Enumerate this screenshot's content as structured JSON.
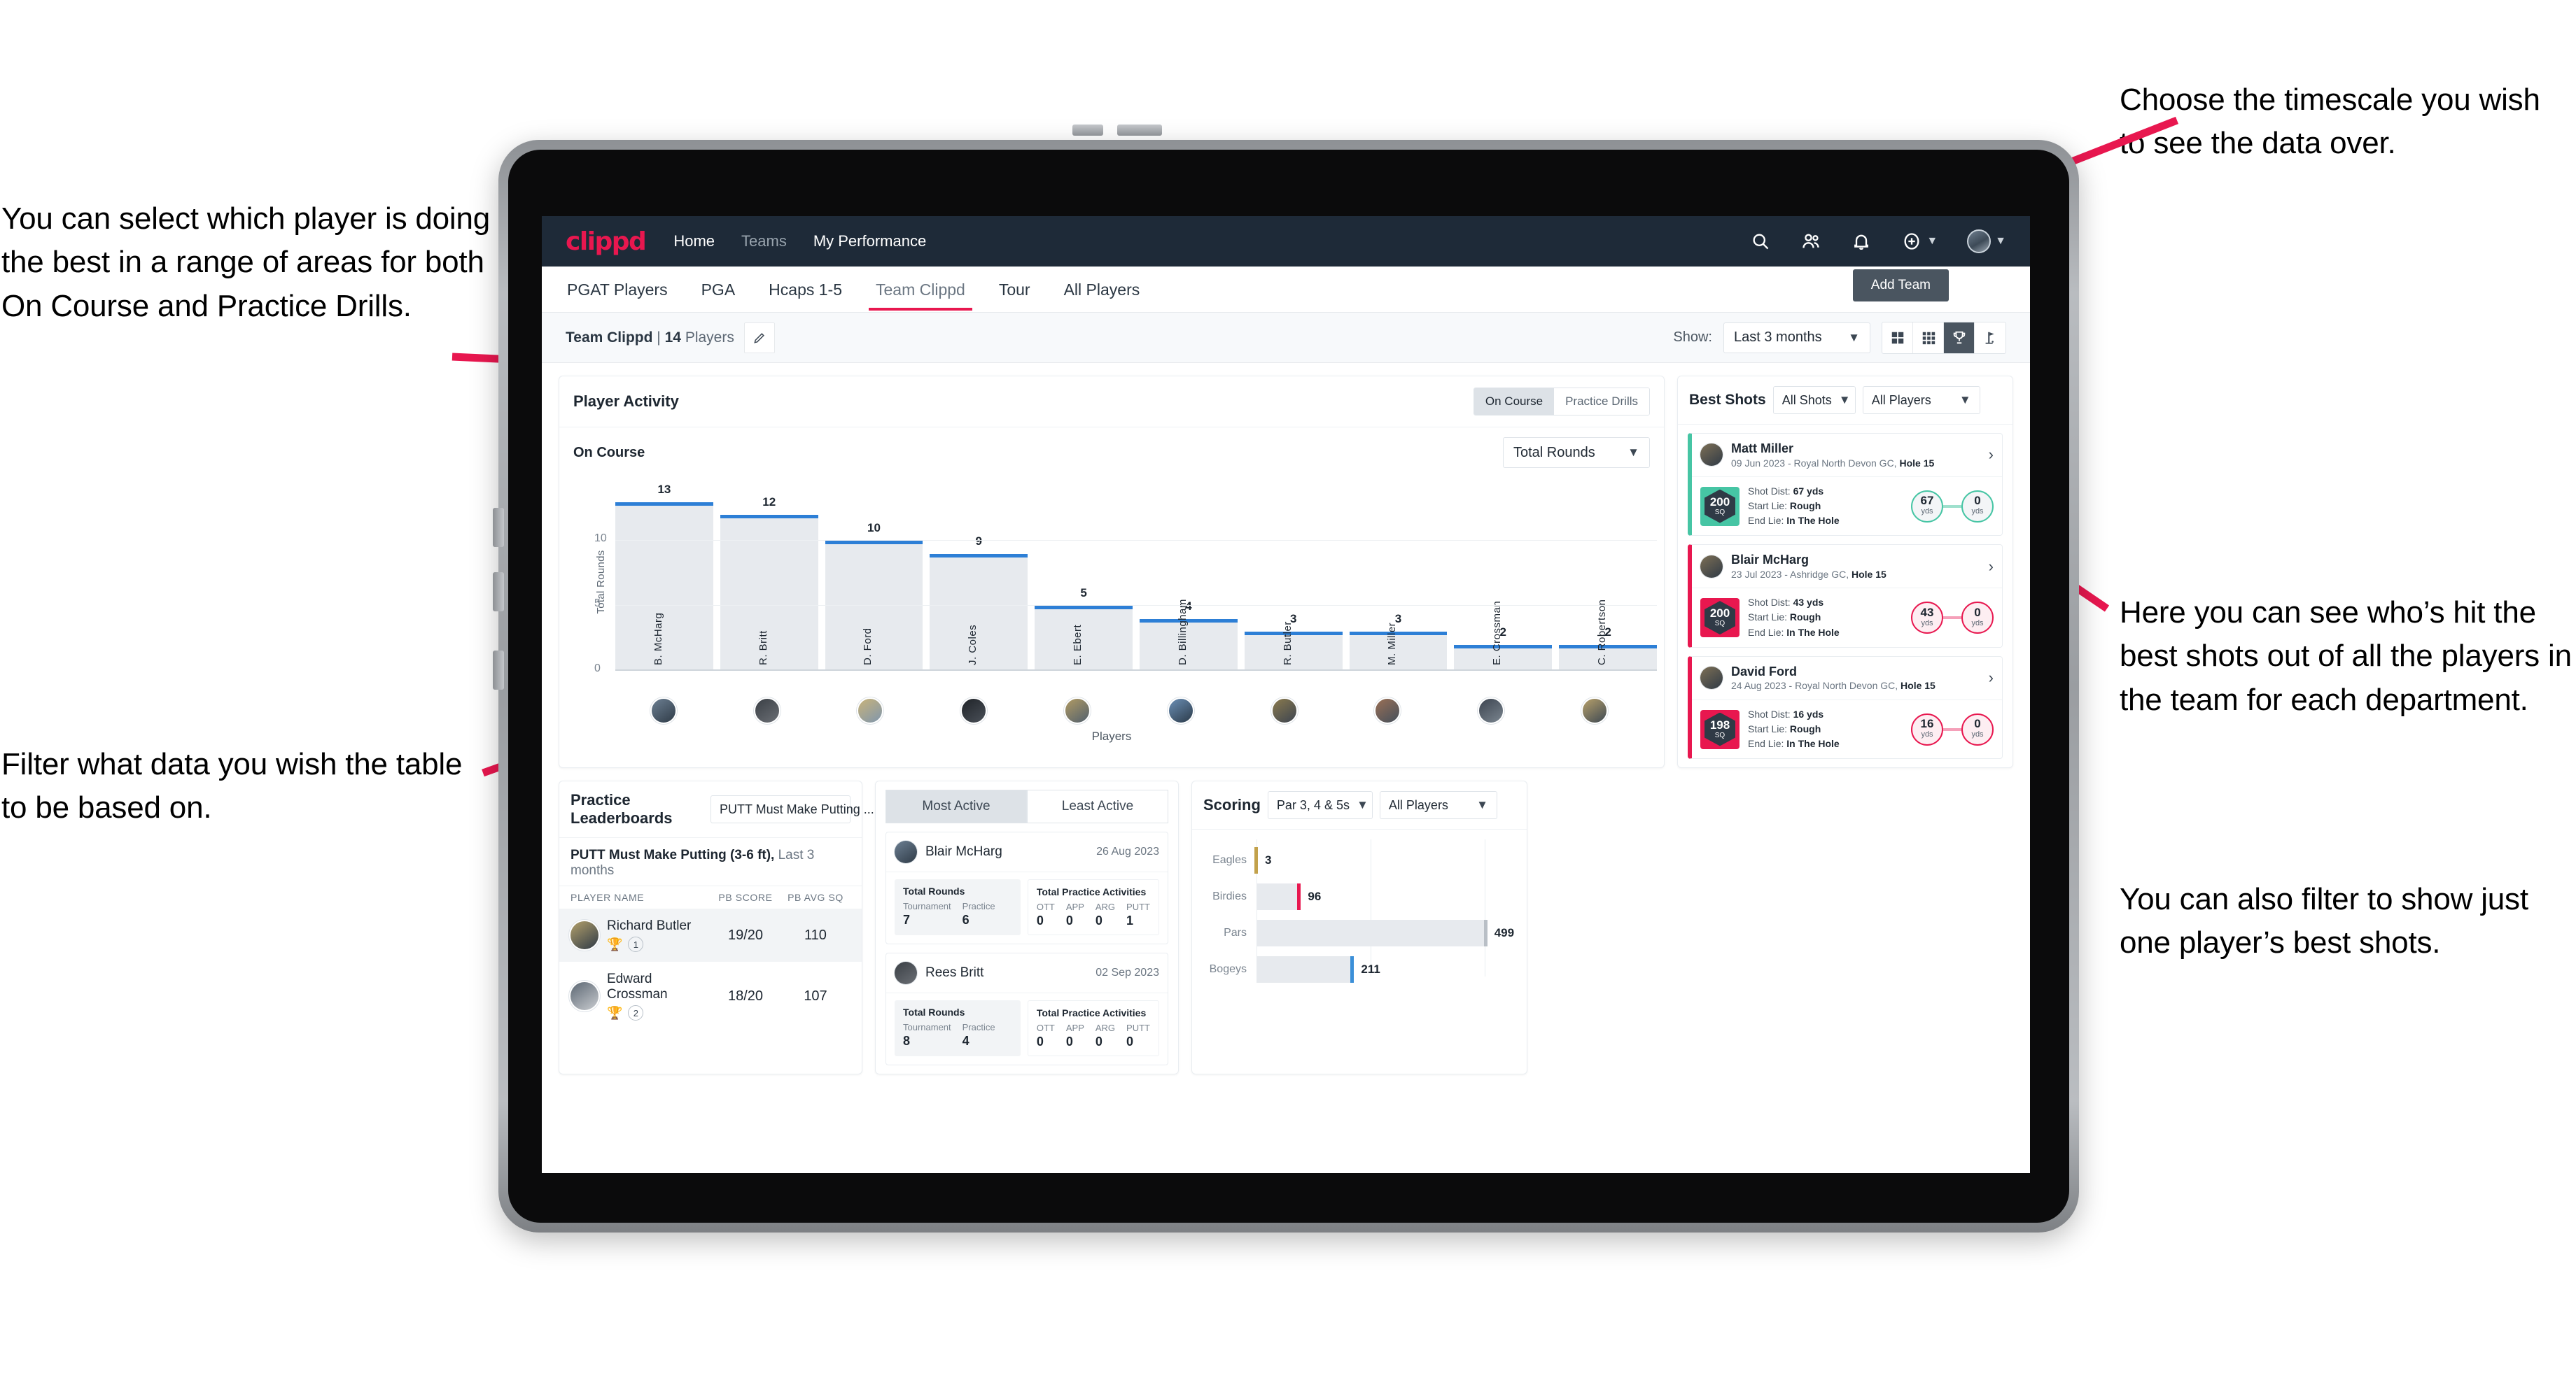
{
  "annotations": {
    "left_top": "You can select which player is doing the best in a range of areas for both On Course and Practice Drills.",
    "left_bottom": "Filter what data you wish the table to be based on.",
    "right_top": "Choose the timescale you wish to see the data over.",
    "right_middle": "Here you can see who’s hit the best shots out of all the players in the team for each department.",
    "right_bottom": "You can also filter to show just one player’s best shots."
  },
  "topnav": {
    "logo": "clippd",
    "links": [
      {
        "label": "Home",
        "active": true
      },
      {
        "label": "Teams",
        "active": false
      },
      {
        "label": "My Performance",
        "active": true
      }
    ],
    "icons": [
      "search-icon",
      "people-icon",
      "bell-icon",
      "plus-circle-icon",
      "avatar"
    ]
  },
  "tabs": [
    {
      "label": "PGAT Players",
      "active": false
    },
    {
      "label": "PGA",
      "active": false
    },
    {
      "label": "Hcaps 1-5",
      "active": false
    },
    {
      "label": "Team Clippd",
      "active": true
    },
    {
      "label": "Tour",
      "active": false
    },
    {
      "label": "All Players",
      "active": false
    }
  ],
  "subbar": {
    "team_name": "Team Clippd",
    "separator": "|",
    "player_count": "14",
    "players_word": "Players",
    "edit_icon": "pencil-icon",
    "show_label": "Show:",
    "period_value": "Last 3 months",
    "add_team_label": "Add Team",
    "view_toggles": [
      {
        "name": "grid-4-icon",
        "active": false
      },
      {
        "name": "grid-9-icon",
        "active": false
      },
      {
        "name": "trophy-icon",
        "active": true
      },
      {
        "name": "golf-flag-icon",
        "active": false
      }
    ]
  },
  "player_activity": {
    "title": "Player Activity",
    "segments": [
      {
        "label": "On Course",
        "active": true
      },
      {
        "label": "Practice Drills",
        "active": false
      }
    ],
    "sub_label": "On Course",
    "metric_value": "Total Rounds"
  },
  "best_shots": {
    "title": "Best Shots",
    "shots_filter": "All Shots",
    "players_filter": "All Players",
    "cards": [
      {
        "name": "Matt Miller",
        "meta_date": "09 Jun 2023",
        "meta_course": "Royal North Devon GC,",
        "meta_hole": "Hole 15",
        "sq": "200",
        "sq_unit": "SQ",
        "accent": "#46c5a4",
        "shot_dist_label": "Shot Dist:",
        "shot_dist": "67 yds",
        "start_lie_label": "Start Lie:",
        "start_lie": "Rough",
        "end_lie_label": "End Lie:",
        "end_lie": "In The Hole",
        "from_val": "67",
        "from_unit": "yds",
        "to_val": "0",
        "to_unit": "yds"
      },
      {
        "name": "Blair McHarg",
        "meta_date": "23 Jul 2023",
        "meta_course": "Ashridge GC,",
        "meta_hole": "Hole 15",
        "sq": "200",
        "sq_unit": "SQ",
        "accent": "#e8174f",
        "shot_dist_label": "Shot Dist:",
        "shot_dist": "43 yds",
        "start_lie_label": "Start Lie:",
        "start_lie": "Rough",
        "end_lie_label": "End Lie:",
        "end_lie": "In The Hole",
        "from_val": "43",
        "from_unit": "yds",
        "to_val": "0",
        "to_unit": "yds"
      },
      {
        "name": "David Ford",
        "meta_date": "24 Aug 2023",
        "meta_course": "Royal North Devon GC,",
        "meta_hole": "Hole 15",
        "sq": "198",
        "sq_unit": "SQ",
        "accent": "#e8174f",
        "shot_dist_label": "Shot Dist:",
        "shot_dist": "16 yds",
        "start_lie_label": "Start Lie:",
        "start_lie": "Rough",
        "end_lie_label": "End Lie:",
        "end_lie": "In The Hole",
        "from_val": "16",
        "from_unit": "yds",
        "to_val": "0",
        "to_unit": "yds"
      }
    ]
  },
  "practice_leaderboards": {
    "title": "Practice Leaderboards",
    "drill_select": "PUTT Must Make Putting ...",
    "sub_title": "PUTT Must Make Putting (3-6 ft),",
    "sub_period": "Last 3 months",
    "columns": [
      "PLAYER NAME",
      "PB SCORE",
      "PB AVG SQ"
    ],
    "rows": [
      {
        "name": "Richard Butler",
        "rank": "1",
        "trophy": "gold",
        "pb_score": "19/20",
        "pb_avg_sq": "110"
      },
      {
        "name": "Edward Crossman",
        "rank": "2",
        "trophy": "silver",
        "pb_score": "18/20",
        "pb_avg_sq": "107"
      }
    ]
  },
  "activity_panel": {
    "tabs": [
      {
        "label": "Most Active",
        "active": true
      },
      {
        "label": "Least Active",
        "active": false
      }
    ],
    "cards": [
      {
        "name": "Blair McHarg",
        "date": "26 Aug 2023",
        "rounds_title": "Total Rounds",
        "rounds": [
          {
            "key": "Tournament",
            "value": "7"
          },
          {
            "key": "Practice",
            "value": "6"
          }
        ],
        "practice_title": "Total Practice Activities",
        "practice": [
          {
            "key": "OTT",
            "value": "0"
          },
          {
            "key": "APP",
            "value": "0"
          },
          {
            "key": "ARG",
            "value": "0"
          },
          {
            "key": "PUTT",
            "value": "1"
          }
        ]
      },
      {
        "name": "Rees Britt",
        "date": "02 Sep 2023",
        "rounds_title": "Total Rounds",
        "rounds": [
          {
            "key": "Tournament",
            "value": "8"
          },
          {
            "key": "Practice",
            "value": "4"
          }
        ],
        "practice_title": "Total Practice Activities",
        "practice": [
          {
            "key": "OTT",
            "value": "0"
          },
          {
            "key": "APP",
            "value": "0"
          },
          {
            "key": "ARG",
            "value": "0"
          },
          {
            "key": "PUTT",
            "value": "0"
          }
        ]
      }
    ]
  },
  "scoring": {
    "title": "Scoring",
    "par_filter": "Par 3, 4 & 5s",
    "players_filter": "All Players"
  },
  "chart_data": [
    {
      "type": "bar",
      "title": "Player Activity — On Course",
      "ylabel": "Total Rounds",
      "xlabel": "Players",
      "ylim": [
        0,
        14
      ],
      "yticks": [
        0,
        5,
        10
      ],
      "grid": true,
      "categories": [
        "B. McHarg",
        "R. Britt",
        "D. Ford",
        "J. Coles",
        "E. Ebert",
        "D. Billingham",
        "R. Butler",
        "M. Miller",
        "E. Crossman",
        "C. Robertson"
      ],
      "values": [
        13,
        12,
        10,
        9,
        5,
        4,
        3,
        3,
        2,
        2
      ],
      "bar_color": "#e7eaee",
      "cap_color": "#2d7fd6"
    },
    {
      "type": "bar",
      "orientation": "horizontal",
      "title": "Scoring",
      "categories": [
        "Eagles",
        "Birdies",
        "Pars",
        "Bogeys"
      ],
      "values": [
        3,
        96,
        499,
        211
      ],
      "xlim": [
        0,
        560
      ],
      "grid": true,
      "cap_colors": [
        "#c2a14b",
        "#e8174f",
        "#b9bfc6",
        "#3b8fd8"
      ]
    }
  ]
}
